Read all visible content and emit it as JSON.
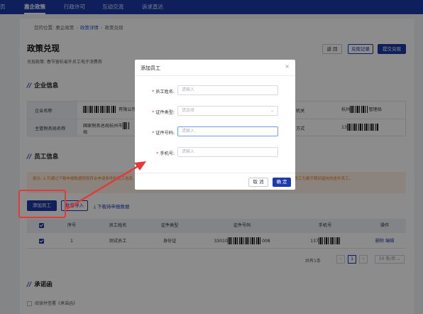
{
  "topnav": {
    "items": [
      "页",
      "惠企政策",
      "行政许可",
      "互动交流",
      "诉求直达"
    ],
    "active_index": 1
  },
  "breadcrumb": {
    "prefix": "您的位置:",
    "items": [
      "惠企政策",
      "政策详情",
      "政策兑现"
    ]
  },
  "page": {
    "title": "政策兑现",
    "subtitle": "兑现政策: 春节留杭省外员工电子消费券",
    "buttons": {
      "back": "返 回",
      "records": "兑现记录",
      "submit": "提交兑现"
    }
  },
  "company_section": {
    "title": "企业信息",
    "rows": [
      {
        "label": "企业名称",
        "value_suffix": "有限公司",
        "right_label": "机关",
        "right_value_prefix": "杭州",
        "right_value_suffix": "管理局"
      },
      {
        "label": "主管税务局名称",
        "value": "国家税务总局杭州市",
        "value_line2": "局",
        "right_label": "方式",
        "right_value_prefix": "13"
      }
    ]
  },
  "employee_section": {
    "title": "员工信息",
    "tip": "提示: 1.可通过下载申报数据获取符合申请条件的员工信息, 再进行批量导入; 2.批量导入单次最多支持200条, 信息不完整将导致上传失败; 3.默认展示的员工为春节期间留杭的省外员工。",
    "add_button": "添加员工",
    "import_button": "批量导入",
    "download_link": "下载待申报数据",
    "table": {
      "columns": [
        "序号",
        "员工姓名",
        "证件类型",
        "证件号码",
        "手机号",
        "操作"
      ],
      "rows": [
        {
          "index": "1",
          "name": "测试员工",
          "id_type": "身份证",
          "id_prefix": "33010",
          "id_suffix": "008",
          "phone_prefix": "137",
          "actions": [
            "删除",
            "编辑"
          ]
        }
      ]
    },
    "pagination": {
      "total": "共有1条",
      "current": "1",
      "page_size": "10 条/页"
    }
  },
  "commitment_section": {
    "title": "承诺函",
    "checkbox_label": "阅读并签署《承诺函》"
  },
  "modal": {
    "title": "添加员工",
    "fields": [
      {
        "label": "员工姓名:",
        "placeholder": "请输入"
      },
      {
        "label": "证件类型:",
        "placeholder": "请选择"
      },
      {
        "label": "证件号码:",
        "placeholder": "请输入"
      },
      {
        "label": "手机号:",
        "placeholder": "请输入"
      }
    ],
    "cancel": "取 消",
    "confirm": "确 定"
  },
  "colors": {
    "brand": "#1d3aa8",
    "annotation": "#e23a3a",
    "tip_text": "#e07a2e"
  }
}
